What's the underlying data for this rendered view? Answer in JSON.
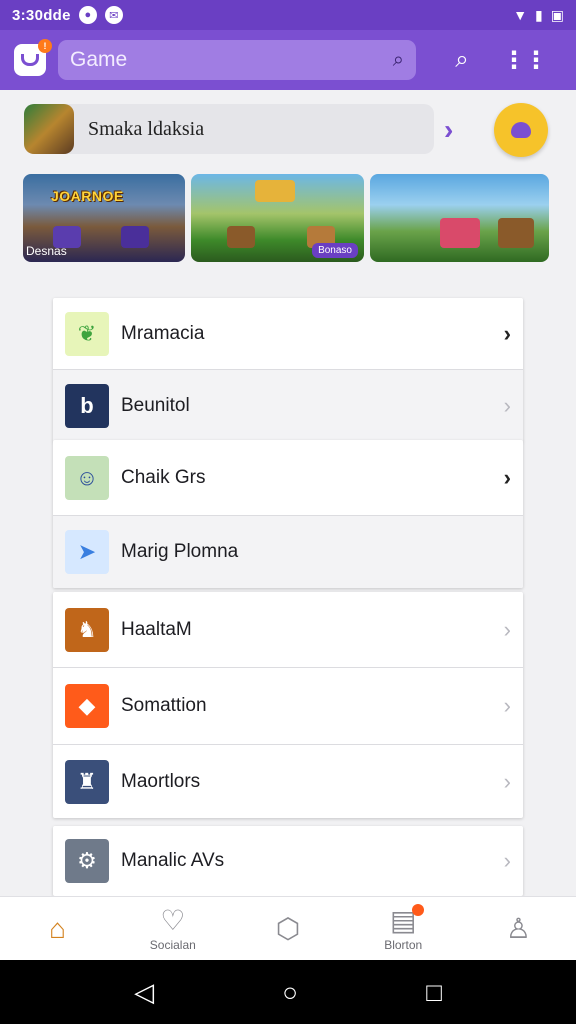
{
  "status_bar": {
    "time": "3:30dde",
    "icons": [
      "notification-icon",
      "chat-icon"
    ],
    "right_icons": [
      "wifi-icon",
      "battery-icon",
      "calendar-icon"
    ]
  },
  "app_bar": {
    "search_placeholder": "Game"
  },
  "featured": {
    "label": "Smaka ldaksia"
  },
  "banners": [
    {
      "title": "JOARNOE",
      "caption": "Desnas"
    },
    {
      "title": "",
      "pill": "Bonaso"
    },
    {
      "title": ""
    }
  ],
  "lists": [
    {
      "items": [
        {
          "label": "Mramacia",
          "icon": "leaf-icon",
          "color": "#e7f5b9",
          "chev_dark": true
        },
        {
          "label": "Beunitol",
          "icon": "b-logo-icon",
          "color": "#22345e",
          "chev_dark": false
        }
      ]
    },
    {
      "items": [
        {
          "label": "Chaik Grs",
          "icon": "character-icon",
          "color": "#c4e0b8",
          "chev_dark": true
        },
        {
          "label": "Marig Plomna",
          "icon": "bird-icon",
          "color": "#d6e8ff",
          "chev_dark": false
        }
      ]
    },
    {
      "items": [
        {
          "label": "HaaltaM",
          "icon": "hero-icon",
          "color": "#c0661a",
          "chev_dark": false
        },
        {
          "label": "Somattion",
          "icon": "card-icon",
          "color": "#ff5b1a",
          "chev_dark": false
        },
        {
          "label": "Maortlors",
          "icon": "warrior-icon",
          "color": "#3a4f7a",
          "chev_dark": false
        }
      ]
    },
    {
      "items": [
        {
          "label": "Manalic AVs",
          "icon": "vehicle-icon",
          "color": "#6f7a8a",
          "chev_dark": false
        }
      ]
    }
  ],
  "bottom_nav": [
    {
      "label": "",
      "icon": "home-icon",
      "active": true
    },
    {
      "label": "Socialan",
      "icon": "heart-icon",
      "active": false
    },
    {
      "label": "",
      "icon": "tag-icon",
      "active": false
    },
    {
      "label": "Blorton",
      "icon": "inbox-icon",
      "active": false,
      "badge": true
    },
    {
      "label": "",
      "icon": "person-icon",
      "active": false
    }
  ],
  "colors": {
    "primary": "#7b4fd1",
    "status": "#6a3fc3",
    "accent": "#f6c32a",
    "badge": "#ff5a1a"
  }
}
